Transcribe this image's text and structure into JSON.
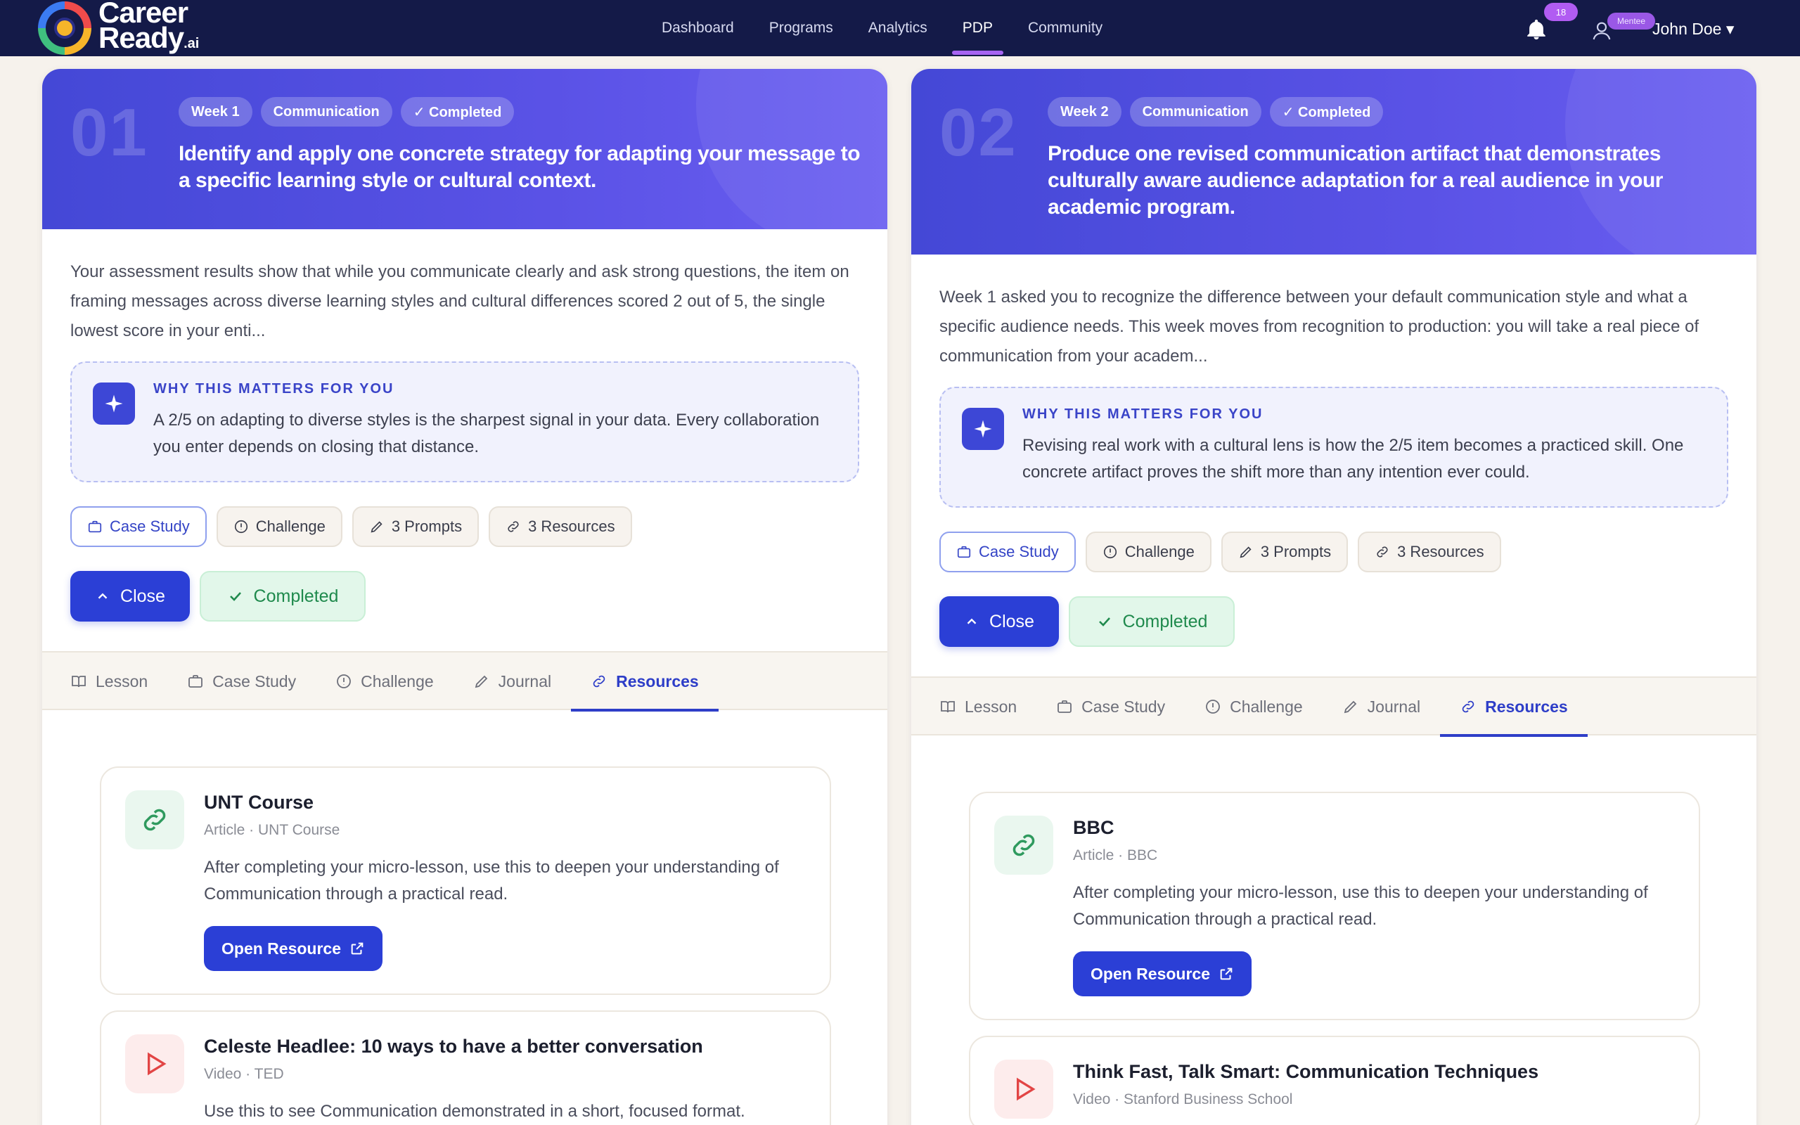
{
  "nav": {
    "logo_line1": "Career",
    "logo_line2": "Ready",
    "logo_suffix": ".ai",
    "links": [
      "Dashboard",
      "Programs",
      "Analytics",
      "PDP",
      "Community"
    ],
    "active": "PDP",
    "notification_count": "18",
    "role_badge": "Mentee",
    "user_name": "John Doe ▾"
  },
  "cards": [
    {
      "week_num": "01",
      "chips": [
        "Week 1",
        "Communication",
        "✓ Completed"
      ],
      "title": "Identify and apply one concrete strategy for adapting your message to a specific learning style or cultural context.",
      "description": "Your assessment results show that while you communicate clearly and ask strong questions, the item on framing messages across diverse learning styles and cultural differences scored 2 out of 5, the single lowest score in your enti...",
      "why_title": "WHY THIS MATTERS FOR YOU",
      "why_text": "A 2/5 on adapting to diverse styles is the sharpest signal in your data. Every collaboration you enter depends on closing that distance.",
      "pills": [
        "Case Study",
        "Challenge",
        "3 Prompts",
        "3 Resources"
      ],
      "close_label": "Close",
      "completed_label": "Completed",
      "tabs": [
        "Lesson",
        "Case Study",
        "Challenge",
        "Journal",
        "Resources"
      ],
      "active_tab": "Resources",
      "resources": [
        {
          "type": "link",
          "title": "UNT Course",
          "meta": "Article · UNT Course",
          "description": "After completing your micro-lesson, use this to deepen your understanding of Communication through a practical read.",
          "button": "Open Resource"
        },
        {
          "type": "video",
          "title": "Celeste Headlee: 10 ways to have a better conversation",
          "meta": "Video · TED",
          "description": "Use this to see Communication demonstrated in a short, focused format."
        }
      ]
    },
    {
      "week_num": "02",
      "chips": [
        "Week 2",
        "Communication",
        "✓ Completed"
      ],
      "title": "Produce one revised communication artifact that demonstrates culturally aware audience adaptation for a real audience in your academic program.",
      "description": "Week 1 asked you to recognize the difference between your default communication style and what a specific audience needs. This week moves from recognition to production: you will take a real piece of communication from your academ...",
      "why_title": "WHY THIS MATTERS FOR YOU",
      "why_text": "Revising real work with a cultural lens is how the 2/5 item becomes a practiced skill. One concrete artifact proves the shift more than any intention ever could.",
      "pills": [
        "Case Study",
        "Challenge",
        "3 Prompts",
        "3 Resources"
      ],
      "close_label": "Close",
      "completed_label": "Completed",
      "tabs": [
        "Lesson",
        "Case Study",
        "Challenge",
        "Journal",
        "Resources"
      ],
      "active_tab": "Resources",
      "resources": [
        {
          "type": "link",
          "title": "BBC",
          "meta": "Article · BBC",
          "description": "After completing your micro-lesson, use this to deepen your understanding of Communication through a practical read.",
          "button": "Open Resource"
        },
        {
          "type": "video",
          "title": "Think Fast, Talk Smart: Communication Techniques",
          "meta": "Video · Stanford Business School",
          "description": ""
        }
      ]
    }
  ]
}
